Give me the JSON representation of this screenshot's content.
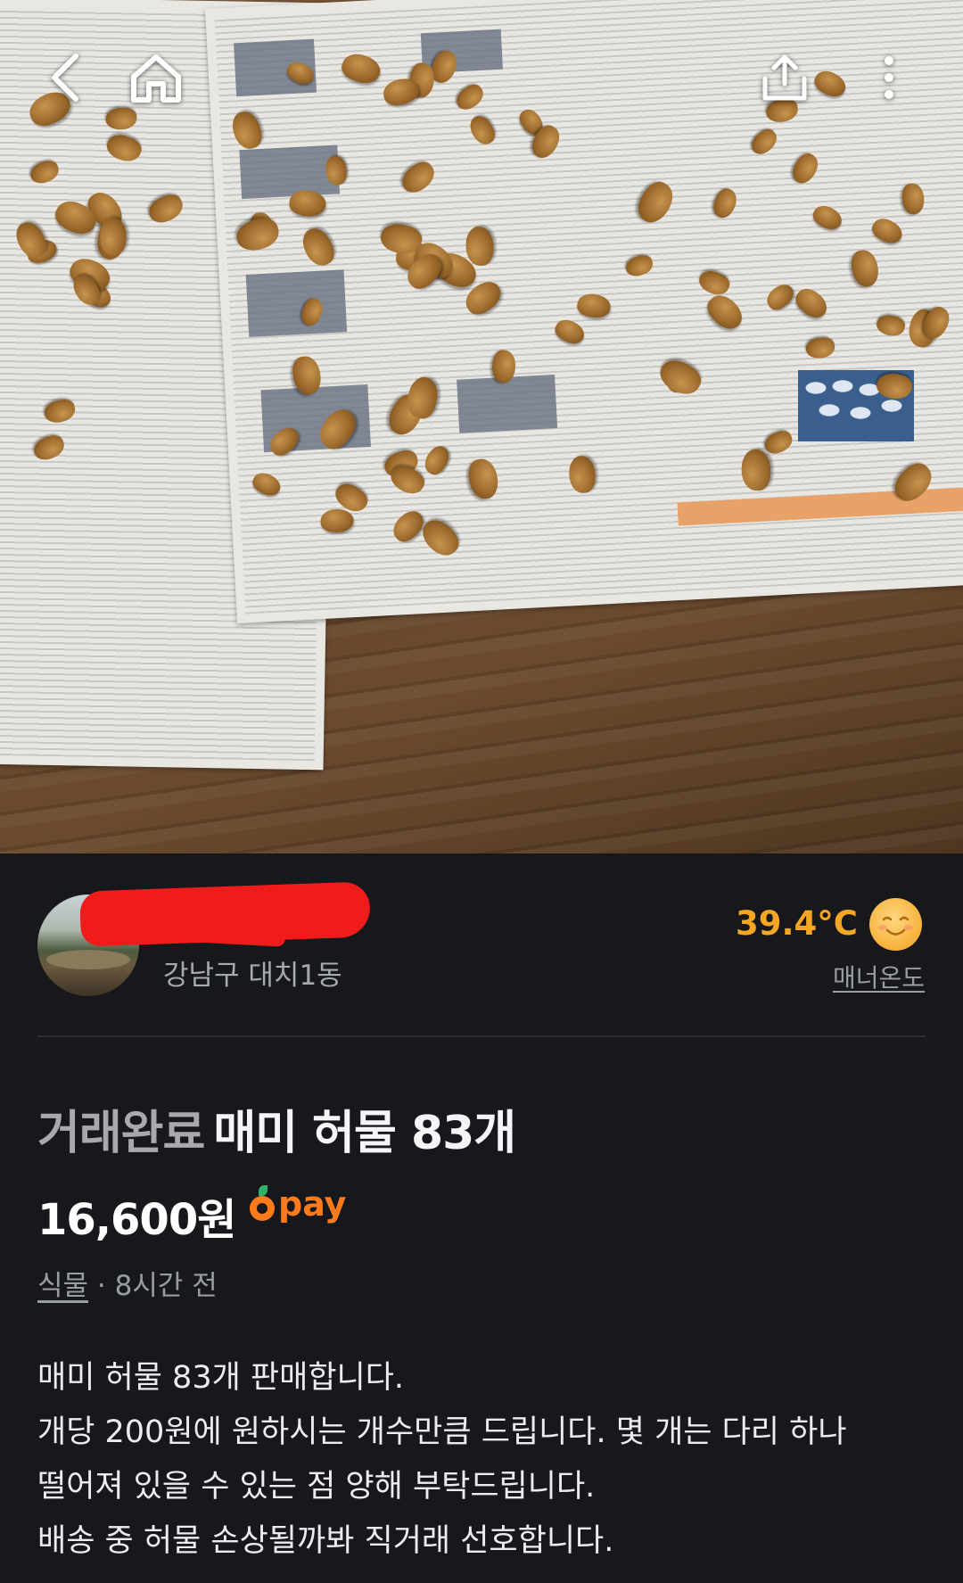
{
  "nav": {
    "back_icon": "chevron-left-icon",
    "home_icon": "home-icon",
    "share_icon": "share-upload-icon",
    "more_icon": "more-vertical-icon"
  },
  "seller": {
    "location": "강남구 대치1동",
    "manner_temp": "39.4°C",
    "manner_label": "매너온도",
    "temp_color": "#f5a623"
  },
  "listing": {
    "status": "거래완료",
    "title": "매미 허물 83개",
    "price": "16,600원",
    "pay_label": "pay",
    "category": "식물",
    "separator": " · ",
    "time_ago": "8시간 전",
    "description": [
      "매미 허물 83개 판매합니다.",
      "개당 200원에 원하시는 개수만큼 드립니다. 몇 개는 다리 하나",
      "떨어져 있을 수 있는 점 양해 부탁드립니다.",
      "배송 중 허물 손상될까봐 직거래 선호합니다."
    ]
  },
  "colors": {
    "background": "#17181c",
    "accent": "#ff7a1a"
  }
}
